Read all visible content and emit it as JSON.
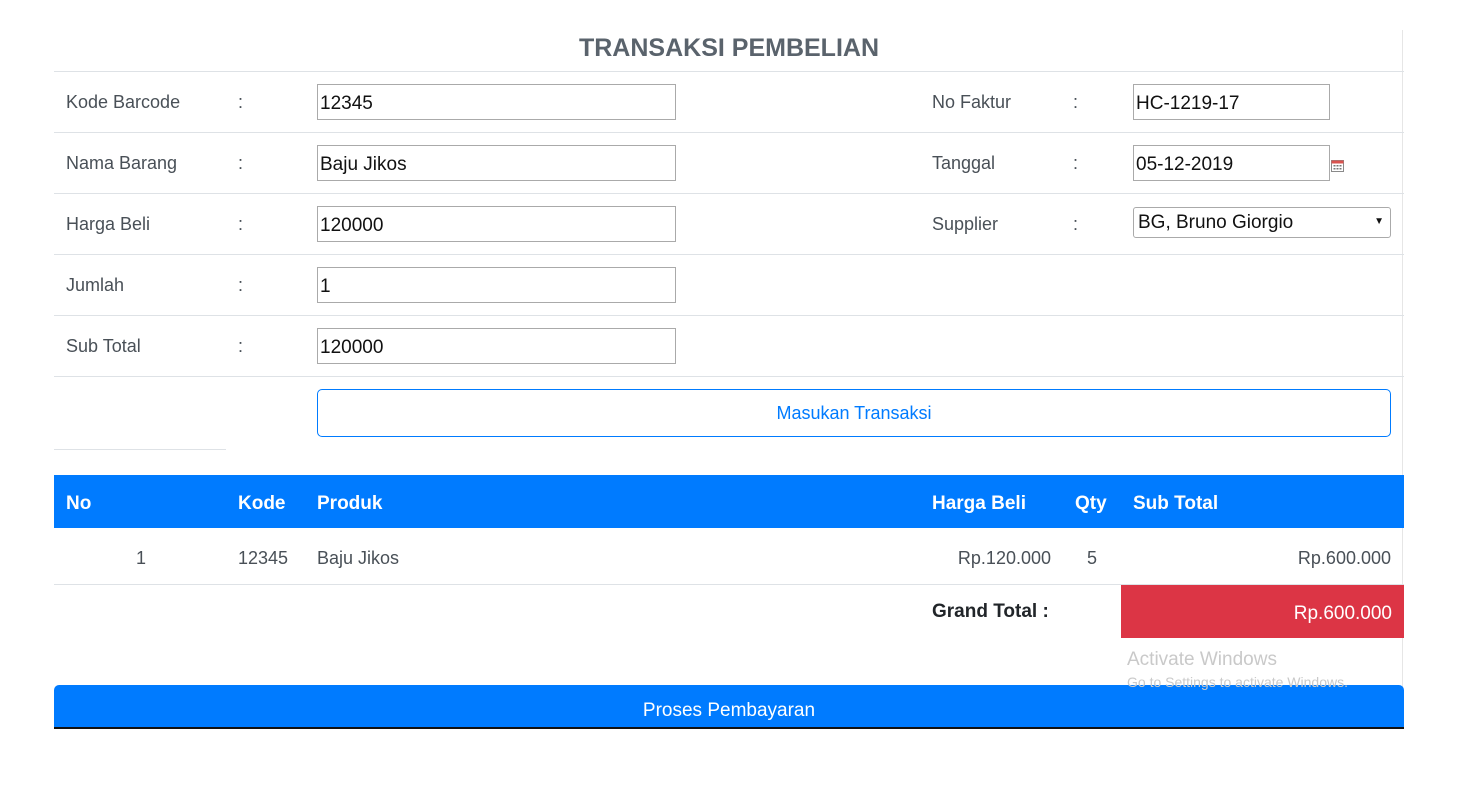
{
  "page": {
    "title": "TRANSAKSI PEMBELIAN"
  },
  "form": {
    "colon": ":",
    "kode_barcode": {
      "label": "Kode Barcode",
      "value": "12345"
    },
    "nama_barang": {
      "label": "Nama Barang",
      "value": "Baju Jikos"
    },
    "harga_beli": {
      "label": "Harga Beli",
      "value": "120000"
    },
    "jumlah": {
      "label": "Jumlah",
      "value": "1"
    },
    "sub_total": {
      "label": "Sub Total",
      "value": "120000"
    },
    "no_faktur": {
      "label": "No Faktur",
      "value": "HC-1219-17"
    },
    "tanggal": {
      "label": "Tanggal",
      "value": "05-12-2019",
      "icon": "calendar-icon"
    },
    "supplier": {
      "label": "Supplier",
      "value": "BG, Bruno Giorgio"
    },
    "submit_label": "Masukan Transaksi"
  },
  "table": {
    "headers": [
      "No",
      "Kode",
      "Produk",
      "Harga Beli",
      "Qty",
      "Sub Total"
    ],
    "rows": [
      [
        "1",
        "12345",
        "Baju Jikos",
        "Rp.120.000",
        "5",
        "Rp.600.000"
      ]
    ],
    "grand_total_label": "Grand Total :",
    "grand_total_value": "Rp.600.000"
  },
  "process_button": "Proses Pembayaran",
  "watermark": {
    "line1": "Activate Windows",
    "line2": "Go to Settings to activate Windows."
  },
  "colors": {
    "primary": "#007bff",
    "danger": "#dc3545",
    "title": "#5a636c"
  }
}
